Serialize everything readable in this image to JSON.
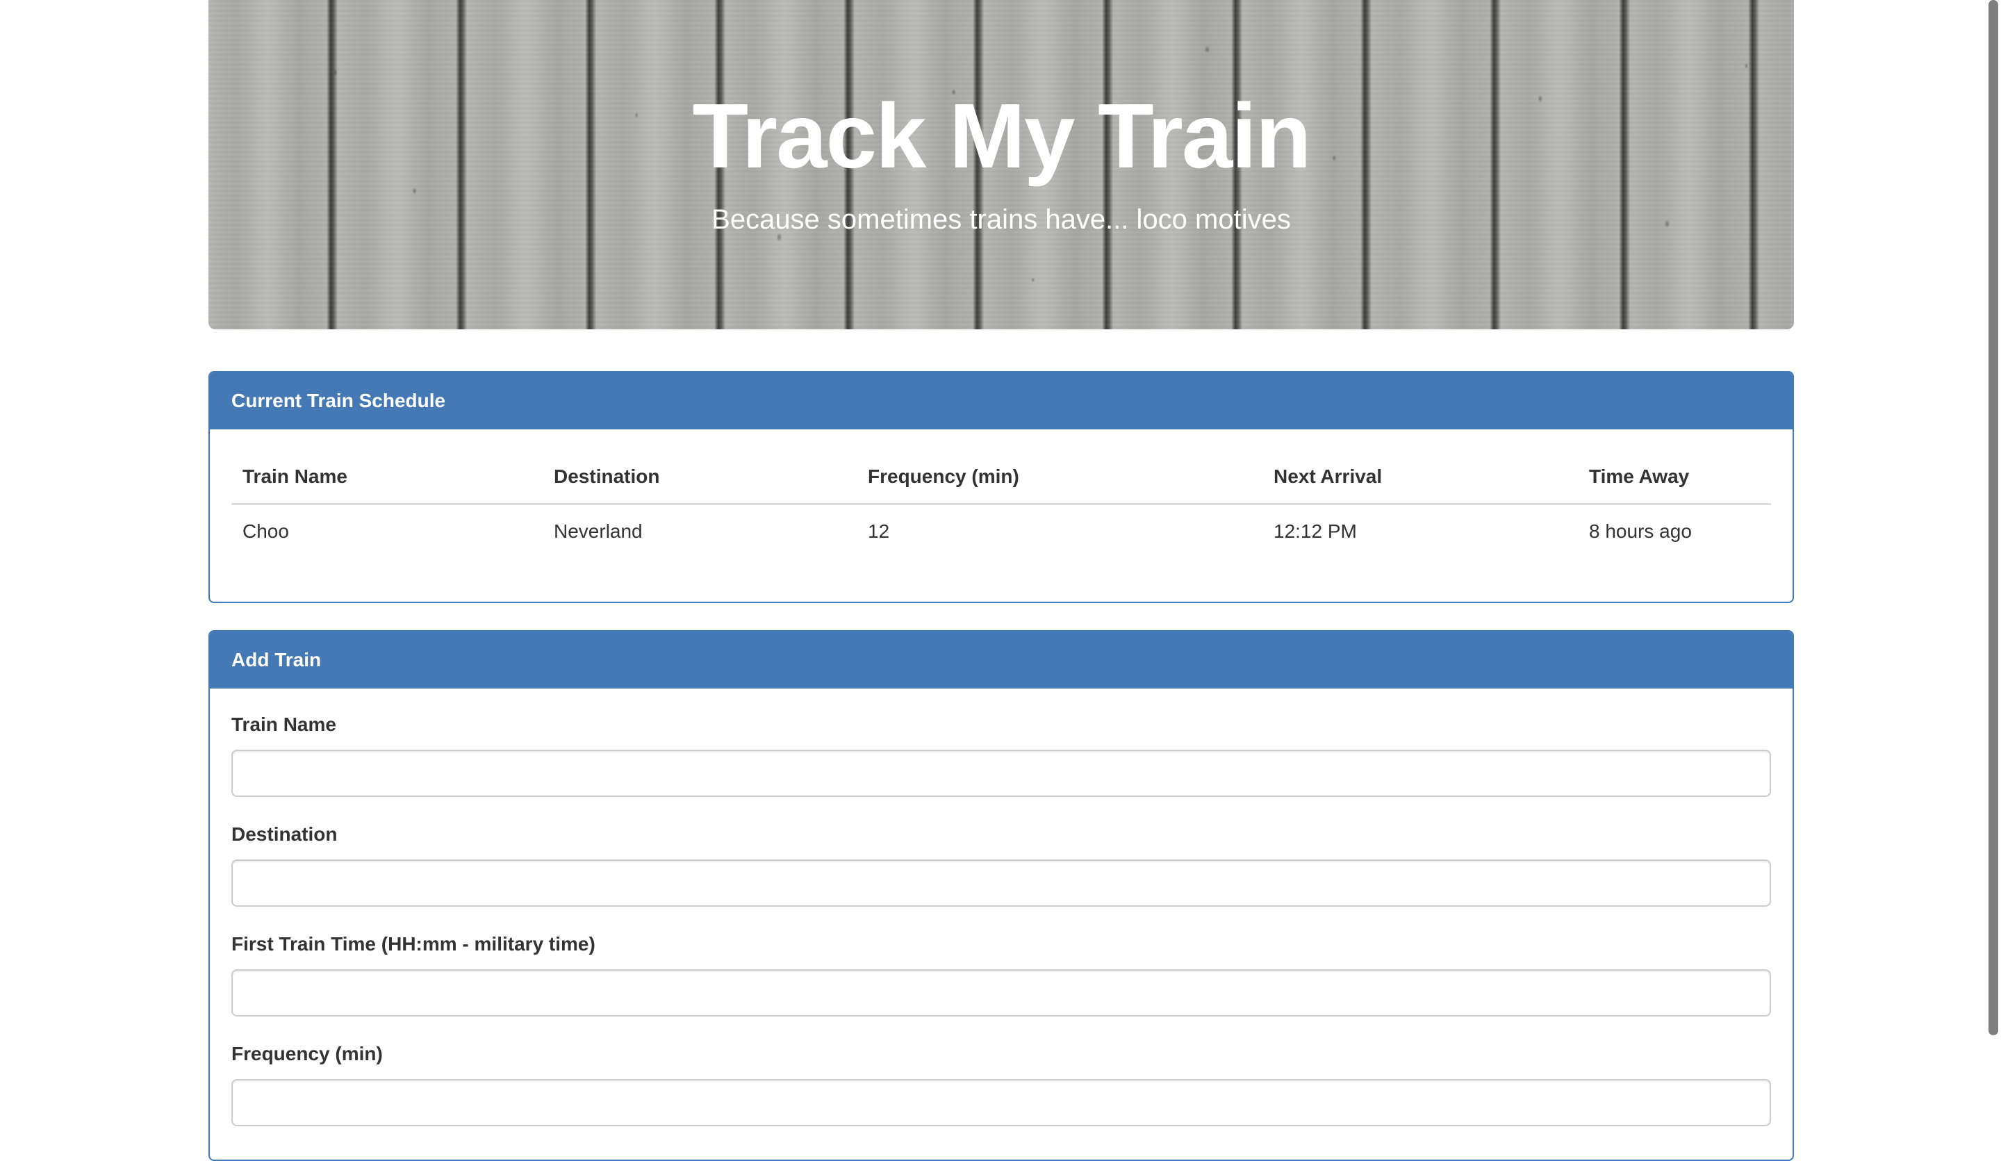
{
  "header": {
    "title": "Track My Train",
    "subtitle": "Because sometimes trains have... loco motives"
  },
  "schedule": {
    "heading": "Current Train Schedule",
    "columns": [
      "Train Name",
      "Destination",
      "Frequency (min)",
      "Next Arrival",
      "Time Away"
    ],
    "rows": [
      {
        "name": "Choo",
        "destination": "Neverland",
        "frequency": "12",
        "next_arrival": "12:12 PM",
        "time_away": "8 hours ago"
      }
    ]
  },
  "add_train": {
    "heading": "Add Train",
    "fields": [
      {
        "label": "Train Name",
        "value": "",
        "placeholder": ""
      },
      {
        "label": "Destination",
        "value": "",
        "placeholder": ""
      },
      {
        "label": "First Train Time (HH:mm - military time)",
        "value": "",
        "placeholder": ""
      },
      {
        "label": "Frequency (min)",
        "value": "",
        "placeholder": ""
      }
    ]
  },
  "colors": {
    "panel_header": "#4479b5",
    "panel_border": "#3f79b6"
  }
}
